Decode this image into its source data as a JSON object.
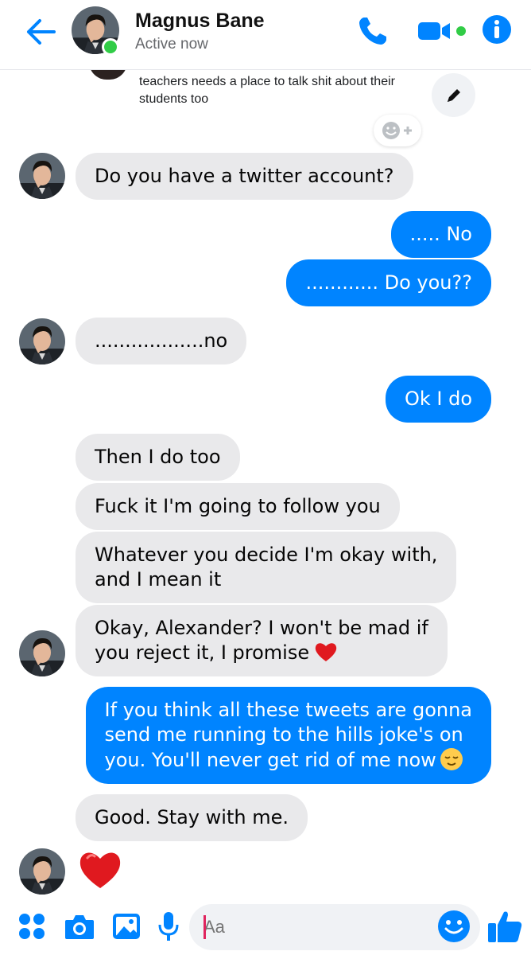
{
  "header": {
    "name": "Magnus Bane",
    "status": "Active now"
  },
  "pinned_preview": {
    "text": "teachers needs a place to talk shit about their students too"
  },
  "messages": [
    {
      "dir": "in",
      "text": "Do you have a twitter account?"
    },
    {
      "dir": "out",
      "text": "..... No"
    },
    {
      "dir": "out",
      "text": "............ Do you??"
    },
    {
      "dir": "in",
      "text": "..................no"
    },
    {
      "dir": "out",
      "text": "Ok I do"
    },
    {
      "dir": "in",
      "text": "Then I do too"
    },
    {
      "dir": "in",
      "text": "Fuck it I'm going to follow you"
    },
    {
      "dir": "in",
      "line1": "Whatever you decide I'm okay with,",
      "line2": "and I mean it"
    },
    {
      "dir": "in",
      "line1": "Okay, Alexander? I won't be mad if",
      "line2": "you reject it, I promise",
      "emoji": "red-heart"
    },
    {
      "dir": "out",
      "line1": "If you think all these tweets are gonna",
      "line2": "send me running to the hills joke's on",
      "line3": "you. You'll never get rid of me now",
      "emoji": "relieved-face"
    },
    {
      "dir": "in",
      "text": "Good. Stay with me."
    },
    {
      "dir": "in",
      "emoji": "red-heart"
    }
  ],
  "composer": {
    "placeholder": "Aa"
  },
  "colors": {
    "accent": "#0084ff",
    "incoming_bubble": "#e9e9eb",
    "online": "#31cc46",
    "heart": "#e0191f"
  },
  "icons": [
    "back-arrow-icon",
    "phone-icon",
    "video-camera-icon",
    "info-icon",
    "edit-pencil-icon",
    "add-reaction-icon",
    "menu-grid-icon",
    "camera-icon",
    "image-icon",
    "microphone-icon",
    "emoji-icon",
    "thumbs-up-icon"
  ]
}
